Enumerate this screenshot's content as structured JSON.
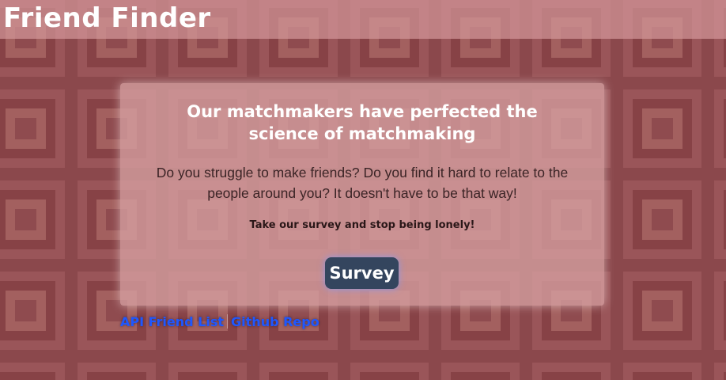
{
  "header": {
    "title": "Friend Finder"
  },
  "card": {
    "heading": "Our matchmakers have perfected the science of matchmaking",
    "body": "Do you struggle to make friends? Do you find it hard to relate to the people around you? It doesn't have to be that way!",
    "call_to_action": "Take our survey and stop being lonely!",
    "survey_button_label": "Survey"
  },
  "footer": {
    "links": [
      {
        "label": "API Friend List"
      },
      {
        "label": "Github Repo"
      }
    ]
  },
  "colors": {
    "background": "#8e4a4e",
    "header_bar": "#d29698",
    "card": "#d6a0a2",
    "survey_button": "#34455e",
    "link": "#1f57ff"
  }
}
